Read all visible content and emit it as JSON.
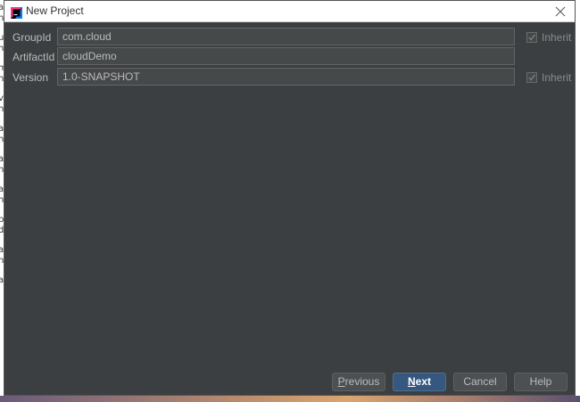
{
  "window": {
    "title": "New Project"
  },
  "background": {
    "left_fragments": [
      "a",
      "h",
      "u",
      "h",
      "m",
      "h",
      "v",
      "h",
      "a",
      "h",
      "a",
      "h",
      "a",
      "h",
      "b",
      "d",
      "a",
      "h",
      "a"
    ]
  },
  "form": {
    "group_id": {
      "label": "GroupId",
      "value": "com.cloud",
      "inherit_label": "Inherit",
      "inherit_checked": true
    },
    "artifact_id": {
      "label": "ArtifactId",
      "value": "cloudDemo"
    },
    "version": {
      "label": "Version",
      "value": "1.0-SNAPSHOT",
      "inherit_label": "Inherit",
      "inherit_checked": true
    }
  },
  "buttons": {
    "previous": {
      "mnemonic": "P",
      "rest": "revious"
    },
    "next": {
      "mnemonic": "N",
      "rest": "ext"
    },
    "cancel": "Cancel",
    "help": "Help"
  },
  "colors": {
    "dialog_bg": "#3c3f41",
    "field_bg": "#45494a",
    "primary_button": "#365880",
    "text": "#bbbbbb"
  }
}
